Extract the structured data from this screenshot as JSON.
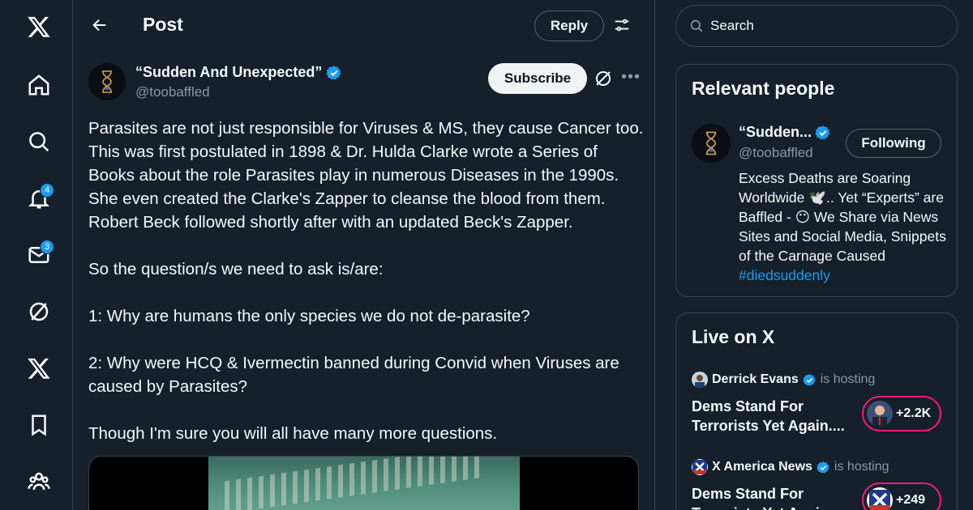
{
  "nav": {
    "items": [
      {
        "name": "x-logo"
      },
      {
        "name": "home"
      },
      {
        "name": "explore"
      },
      {
        "name": "notifications",
        "badge": "4"
      },
      {
        "name": "messages",
        "badge": "3"
      },
      {
        "name": "grok"
      },
      {
        "name": "premium"
      },
      {
        "name": "bookmarks"
      },
      {
        "name": "communities"
      }
    ]
  },
  "header": {
    "title": "Post",
    "reply_label": "Reply"
  },
  "post": {
    "author_name": "“Sudden And Unexpected”",
    "author_handle": "@toobaffled",
    "subscribe_label": "Subscribe",
    "paragraphs": [
      "Parasites are not just responsible for Viruses & MS, they cause Cancer too. This was first postulated in 1898 & Dr. Hulda Clarke wrote a Series of Books about the role Parasites play in numerous Diseases in the 1990s. She even created the Clarke's Zapper to cleanse the blood from them. Robert Beck followed shortly after with an updated Beck's Zapper.",
      "So the question/s we need to ask is/are:",
      "1: Why are humans the only species we do not de-parasite?",
      "2: Why were HCQ & Ivermectin banned during Convid when Viruses are caused by Parasites?",
      "Though I'm sure you will all have many more questions."
    ]
  },
  "search": {
    "placeholder": "Search"
  },
  "relevant_people": {
    "title": "Relevant people",
    "name": "“Sudden...",
    "handle": "@toobaffled",
    "following_label": "Following",
    "bio_text": "Excess Deaths are Soaring Worldwide 🕊️.. Yet “Experts” are Baffled - 😶 We Share via News Sites and Social Media, Snippets of the Carnage Caused ",
    "bio_hashtag": "#diedsuddenly"
  },
  "live": {
    "title": "Live on X",
    "spaces": [
      {
        "host": "Derrick Evans",
        "tag": "is hosting",
        "title": "Dems Stand For Terrorists Yet Again....",
        "count": "+2.2K"
      },
      {
        "host": "X America News",
        "tag": "is hosting",
        "title": "Dems Stand For Terrorists Yet Again...",
        "count": "+249"
      }
    ]
  },
  "colors": {
    "background": "#15202b",
    "border": "#38444d",
    "accent": "#1d9bf0",
    "live": "#f91880",
    "muted": "#8b98a5"
  }
}
